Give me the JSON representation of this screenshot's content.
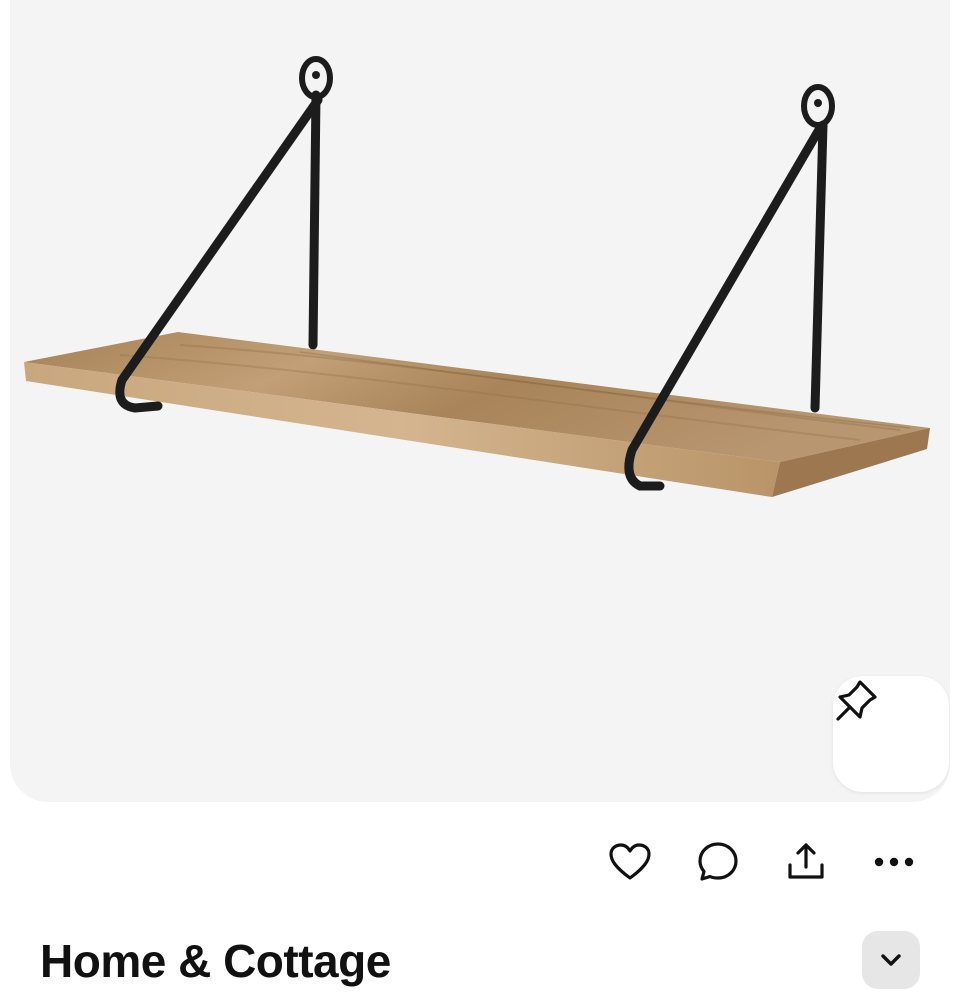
{
  "product": {
    "image_description_icon": "wall-shelf-image"
  },
  "actions": {
    "pin_icon": "pushpin-icon",
    "like_icon": "heart-icon",
    "comment_icon": "speech-bubble-icon",
    "share_icon": "share-icon",
    "more_icon": "ellipsis-icon"
  },
  "board": {
    "title": "Home & Cottage",
    "dropdown_icon": "chevron-down-icon"
  },
  "colors": {
    "image_background": "#f4f4f5",
    "wood": "#b08a5e",
    "metal": "#1c1c1c",
    "dropdown_background": "#e6e6e6"
  }
}
